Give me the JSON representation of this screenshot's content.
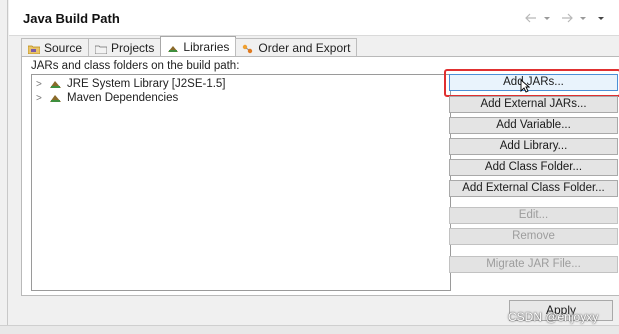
{
  "header": {
    "title": "Java Build Path"
  },
  "tabs": [
    {
      "label": "Source",
      "icon": "source-folder-icon"
    },
    {
      "label": "Projects",
      "icon": "projects-icon"
    },
    {
      "label": "Libraries",
      "icon": "libraries-icon",
      "active": true
    },
    {
      "label": "Order and Export",
      "icon": "order-export-icon"
    }
  ],
  "content": {
    "caption": "JARs and class folders on the build path:",
    "tree": [
      {
        "label": "JRE System Library [J2SE-1.5]"
      },
      {
        "label": "Maven Dependencies"
      }
    ]
  },
  "buttons": {
    "add_jars": "Add JARs...",
    "add_external_jars": "Add External JARs...",
    "add_variable": "Add Variable...",
    "add_library": "Add Library...",
    "add_class_folder": "Add Class Folder...",
    "add_external_class_folder": "Add External Class Folder...",
    "edit": "Edit...",
    "remove": "Remove",
    "migrate_jar": "Migrate JAR File..."
  },
  "footer": {
    "apply": "Apply",
    "watermark": "CSDN @enjoyxy"
  },
  "colors": {
    "highlight_frame": "#e03030",
    "hover_button": "#e9f3fc"
  }
}
